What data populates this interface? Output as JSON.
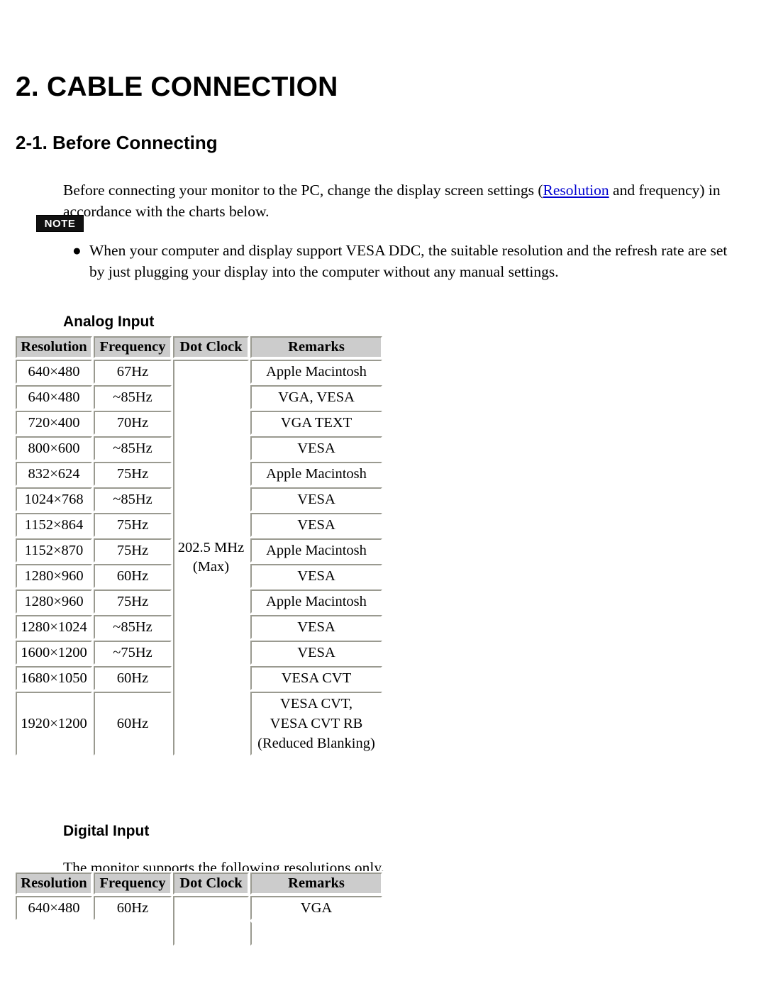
{
  "document": {
    "chapter_title": "2. CABLE CONNECTION",
    "section_title": "2-1. Before Connecting",
    "intro_paragraph_part1": "Before connecting your monitor to the PC, change the display screen settings (",
    "intro_link": "Resolution",
    "intro_paragraph_part2": " and frequency) in accordance with the charts below.",
    "note_badge": "NOTE",
    "note_bullet_glyph": "●",
    "note_items": [
      "When your computer and display support VESA DDC, the suitable resolution and the refresh rate are set by just plugging your display into the computer without any manual settings."
    ]
  },
  "analog": {
    "heading": "Analog Input",
    "columns": [
      "Resolution",
      "Frequency",
      "Dot Clock",
      "Remarks"
    ],
    "dot_clock": "202.5 MHz\n(Max)",
    "dot_clock_line1": "202.5 MHz",
    "dot_clock_line2": "(Max)",
    "rows": [
      {
        "resolution": "640×480",
        "frequency": "67Hz",
        "remarks": "Apple Macintosh"
      },
      {
        "resolution": "640×480",
        "frequency": "~85Hz",
        "remarks": "VGA, VESA"
      },
      {
        "resolution": "720×400",
        "frequency": "70Hz",
        "remarks": "VGA TEXT"
      },
      {
        "resolution": "800×600",
        "frequency": "~85Hz",
        "remarks": "VESA"
      },
      {
        "resolution": "832×624",
        "frequency": "75Hz",
        "remarks": "Apple Macintosh"
      },
      {
        "resolution": "1024×768",
        "frequency": "~85Hz",
        "remarks": "VESA"
      },
      {
        "resolution": "1152×864",
        "frequency": "75Hz",
        "remarks": "VESA"
      },
      {
        "resolution": "1152×870",
        "frequency": "75Hz",
        "remarks": "Apple Macintosh"
      },
      {
        "resolution": "1280×960",
        "frequency": "60Hz",
        "remarks": "VESA"
      },
      {
        "resolution": "1280×960",
        "frequency": "75Hz",
        "remarks": "Apple Macintosh"
      },
      {
        "resolution": "1280×1024",
        "frequency": "~85Hz",
        "remarks": "VESA"
      },
      {
        "resolution": "1600×1200",
        "frequency": "~75Hz",
        "remarks": "VESA"
      },
      {
        "resolution": "1680×1050",
        "frequency": "60Hz",
        "remarks": "VESA CVT"
      }
    ],
    "last_row": {
      "resolution": "1920×1200",
      "frequency": "60Hz",
      "remarks_line1": "VESA CVT,",
      "remarks_line2": "VESA CVT RB",
      "remarks_line3": "(Reduced Blanking)"
    }
  },
  "digital": {
    "heading": "Digital Input",
    "description": "The monitor supports the following resolutions only.",
    "columns": [
      "Resolution",
      "Frequency",
      "Dot Clock",
      "Remarks"
    ],
    "rows": [
      {
        "resolution": "640×480",
        "frequency": "60Hz",
        "dot_clock": "",
        "remarks": "VGA"
      }
    ]
  },
  "colors": {
    "link": "#0000d0",
    "header_bg": "#cccccc",
    "border_dark": "#9a9a90",
    "note_bg": "#111111",
    "text": "#000000"
  }
}
